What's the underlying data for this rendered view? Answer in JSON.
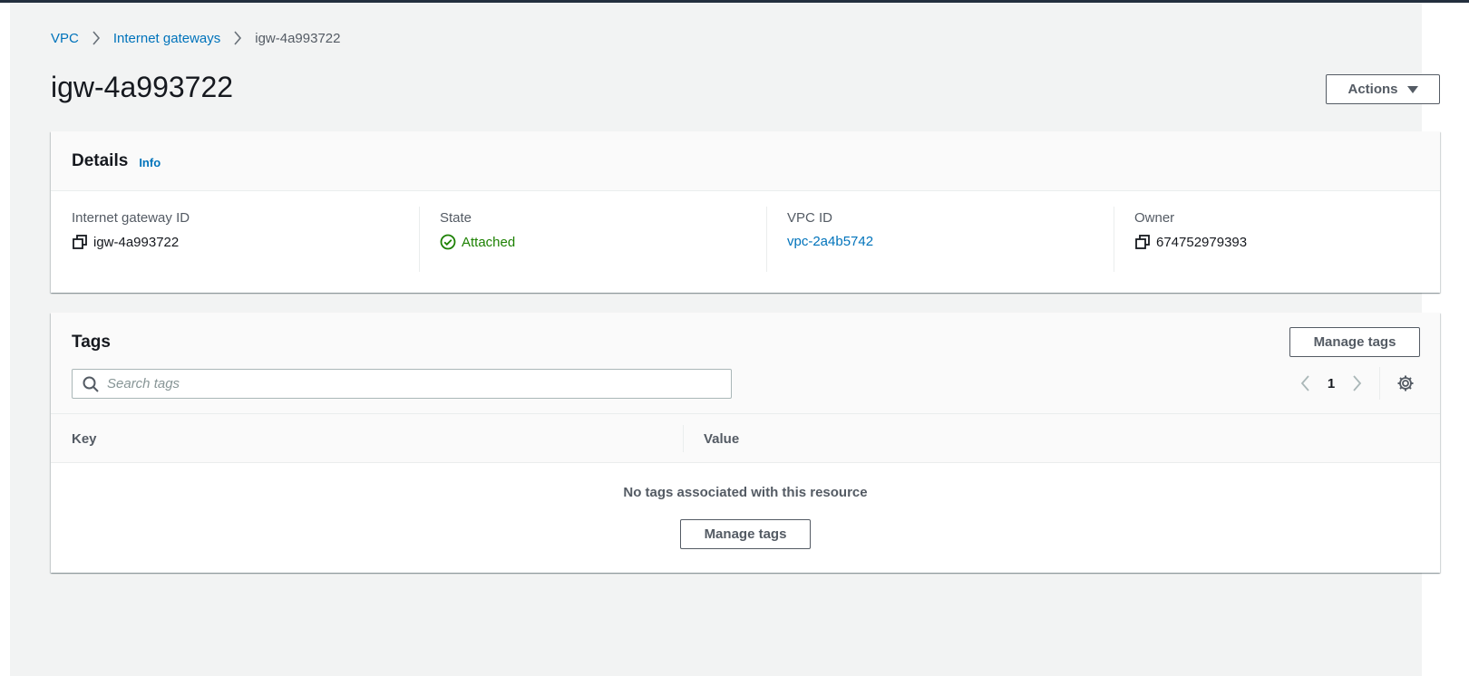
{
  "breadcrumb": {
    "items": [
      "VPC",
      "Internet gateways"
    ],
    "current": "igw-4a993722"
  },
  "page": {
    "title": "igw-4a993722",
    "actions_label": "Actions"
  },
  "details": {
    "title": "Details",
    "info_label": "Info",
    "fields": [
      {
        "label": "Internet gateway ID",
        "value": "igw-4a993722"
      },
      {
        "label": "State",
        "value": "Attached"
      },
      {
        "label": "VPC ID",
        "value": "vpc-2a4b5742"
      },
      {
        "label": "Owner",
        "value": "674752979393"
      }
    ]
  },
  "tags": {
    "title": "Tags",
    "manage_label": "Manage tags",
    "search_placeholder": "Search tags",
    "search_value": "",
    "page_number": "1",
    "columns": [
      "Key",
      "Value"
    ],
    "empty_text": "No tags associated with this resource",
    "empty_manage_label": "Manage tags"
  },
  "colors": {
    "link": "#0073bb",
    "success": "#1d8102",
    "background": "#f2f3f3",
    "topbar": "#232f3e"
  },
  "icons": {
    "breadcrumb_separator": "chevron-right-icon",
    "actions_caret": "caret-down-icon",
    "copy": "copy-icon",
    "state": "status-success-icon",
    "search": "search-icon",
    "prev": "chevron-left-icon",
    "next": "chevron-right-icon",
    "settings": "gear-icon"
  }
}
